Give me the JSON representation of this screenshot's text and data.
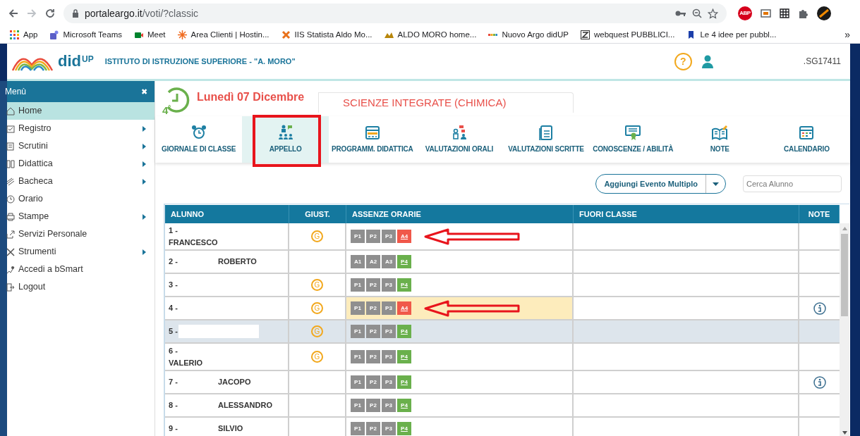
{
  "browser": {
    "url_host": "portaleargo.it",
    "url_path": "/voti/?classic",
    "extension_badge": "ABP",
    "bookmarks": [
      "App",
      "Microsoft Teams",
      "Meet",
      "Area Clienti | Hostin...",
      "IIS Statista Aldo Mo...",
      "ALDO MORO home...",
      "Nuovo Argo didUP",
      "webquest PUBBLICI...",
      "Le 4 idee per pubbl...",
      "»"
    ]
  },
  "header": {
    "logo": "did",
    "logo_sup": "UP",
    "school": "ISTITUTO DI ISTRUZIONE SUPERIORE - \"A. MORO\"",
    "help": "?",
    "user_code": ".SG17411"
  },
  "sidebar": {
    "title": "Menù",
    "close": "✖",
    "items": [
      {
        "label": "Home",
        "submenu": false,
        "selected": true
      },
      {
        "label": "Registro",
        "submenu": true,
        "selected": false
      },
      {
        "label": "Scrutini",
        "submenu": true,
        "selected": false
      },
      {
        "label": "Didattica",
        "submenu": true,
        "selected": false
      },
      {
        "label": "Bacheca",
        "submenu": true,
        "selected": false
      },
      {
        "label": "Orario",
        "submenu": false,
        "selected": false
      },
      {
        "label": "Stampe",
        "submenu": true,
        "selected": false
      },
      {
        "label": "Servizi Personale",
        "submenu": false,
        "selected": false
      },
      {
        "label": "Strumenti",
        "submenu": true,
        "selected": false
      },
      {
        "label": "Accedi a bSmart",
        "submenu": false,
        "selected": false
      },
      {
        "label": "Logout",
        "submenu": false,
        "selected": false
      }
    ]
  },
  "lesson": {
    "hour": "4",
    "hour_mark": "°",
    "date": "Lunedì 07 Dicembre",
    "subject": "SCIENZE INTEGRATE (CHIMICA)"
  },
  "toolbar": [
    {
      "label": "GIORNALE DI CLASSE",
      "selected": false,
      "framed": false
    },
    {
      "label": "APPELLO",
      "selected": true,
      "framed": true
    },
    {
      "label": "PROGRAMM. DIDATTICA",
      "selected": false,
      "framed": false
    },
    {
      "label": "VALUTAZIONI ORALI",
      "selected": false,
      "framed": false
    },
    {
      "label": "VALUTAZIONI SCRITTE",
      "selected": false,
      "framed": false
    },
    {
      "label": "CONOSCENZE / ABILITÀ",
      "selected": false,
      "framed": false
    },
    {
      "label": "NOTE",
      "selected": false,
      "framed": false
    },
    {
      "label": "CALENDARIO",
      "selected": false,
      "framed": false
    }
  ],
  "actions": {
    "multi_event": "Aggiungi Evento Multiplo",
    "search_placeholder": "Cerca Alunno"
  },
  "table": {
    "columns": [
      "ALUNNO",
      "GIUST.",
      "ASSENZE ORARIE",
      "FUORI CLASSE",
      "NOTE"
    ],
    "rows": [
      {
        "number": "1 -",
        "name": "FRANCESCO",
        "name_below": true,
        "redacted": false,
        "giust": "G",
        "hours": [
          {
            "label": "P1",
            "kind": "past"
          },
          {
            "label": "P2",
            "kind": "past"
          },
          {
            "label": "P3",
            "kind": "past"
          },
          {
            "label": "A4",
            "kind": "absent"
          }
        ],
        "note": false,
        "highlighted": false,
        "selected": false,
        "arrow": true
      },
      {
        "number": "2 -",
        "name": "ROBERTO",
        "name_below": false,
        "redacted": false,
        "hours": [
          {
            "label": "A1",
            "kind": "past"
          },
          {
            "label": "A2",
            "kind": "past"
          },
          {
            "label": "A3",
            "kind": "past"
          },
          {
            "label": "P4",
            "kind": "present"
          }
        ],
        "note": false,
        "highlighted": false,
        "selected": false,
        "arrow": false
      },
      {
        "number": "3 -",
        "name_below": false,
        "redacted": false,
        "giust": "G",
        "hours": [
          {
            "label": "P1",
            "kind": "past"
          },
          {
            "label": "P2",
            "kind": "past"
          },
          {
            "label": "P3",
            "kind": "past"
          },
          {
            "label": "P4",
            "kind": "present"
          }
        ],
        "note": false,
        "highlighted": false,
        "selected": false,
        "arrow": false
      },
      {
        "number": "4 -",
        "name_below": false,
        "redacted": false,
        "giust": "G",
        "hours": [
          {
            "label": "P1",
            "kind": "past"
          },
          {
            "label": "P2",
            "kind": "past"
          },
          {
            "label": "P3",
            "kind": "past"
          },
          {
            "label": "A4",
            "kind": "absent"
          }
        ],
        "note": true,
        "highlighted": true,
        "selected": false,
        "arrow": true
      },
      {
        "number": "5 -",
        "name_below": false,
        "redacted": true,
        "giust": "G",
        "hours": [
          {
            "label": "P1",
            "kind": "past"
          },
          {
            "label": "P2",
            "kind": "past"
          },
          {
            "label": "P3",
            "kind": "past"
          },
          {
            "label": "P4",
            "kind": "present"
          }
        ],
        "note": false,
        "highlighted": false,
        "selected": true,
        "arrow": false
      },
      {
        "number": "6 -",
        "name": "VALERIO",
        "name_below": true,
        "redacted": false,
        "giust": "G",
        "hours": [
          {
            "label": "P1",
            "kind": "past"
          },
          {
            "label": "P2",
            "kind": "past"
          },
          {
            "label": "P3",
            "kind": "past"
          },
          {
            "label": "P4",
            "kind": "present"
          }
        ],
        "note": false,
        "highlighted": false,
        "selected": false,
        "arrow": false
      },
      {
        "number": "7 -",
        "name": "JACOPO",
        "name_below": false,
        "redacted": false,
        "hours": [
          {
            "label": "P1",
            "kind": "past"
          },
          {
            "label": "P2",
            "kind": "past"
          },
          {
            "label": "P3",
            "kind": "past"
          },
          {
            "label": "P4",
            "kind": "present"
          }
        ],
        "note": true,
        "highlighted": false,
        "selected": false,
        "arrow": false
      },
      {
        "number": "8 -",
        "name": "ALESSANDRO",
        "name_below": false,
        "redacted": false,
        "hours": [
          {
            "label": "P1",
            "kind": "past"
          },
          {
            "label": "P2",
            "kind": "past"
          },
          {
            "label": "P3",
            "kind": "past"
          },
          {
            "label": "P4",
            "kind": "present"
          }
        ],
        "note": false,
        "highlighted": false,
        "selected": false,
        "arrow": false
      },
      {
        "number": "9 -",
        "name": "SILVIO",
        "name_below": false,
        "redacted": false,
        "hours": [
          {
            "label": "P1",
            "kind": "past"
          },
          {
            "label": "P2",
            "kind": "past"
          },
          {
            "label": "P3",
            "kind": "past"
          },
          {
            "label": "P4",
            "kind": "present"
          }
        ],
        "note": false,
        "highlighted": false,
        "selected": false,
        "arrow": false
      }
    ]
  }
}
